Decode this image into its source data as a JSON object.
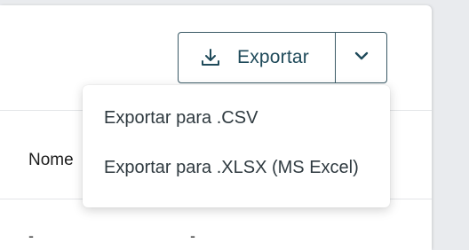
{
  "export_button": {
    "label": "Exportar",
    "icon": "download-icon",
    "toggle_icon": "chevron-down-icon",
    "color": "#1f4a5a"
  },
  "table": {
    "column_header": "Nome",
    "row_cells": [
      "-",
      "-"
    ]
  },
  "export_menu": {
    "items": [
      {
        "label": "Exportar para .CSV"
      },
      {
        "label": "Exportar para .XLSX (MS Excel)"
      }
    ]
  }
}
